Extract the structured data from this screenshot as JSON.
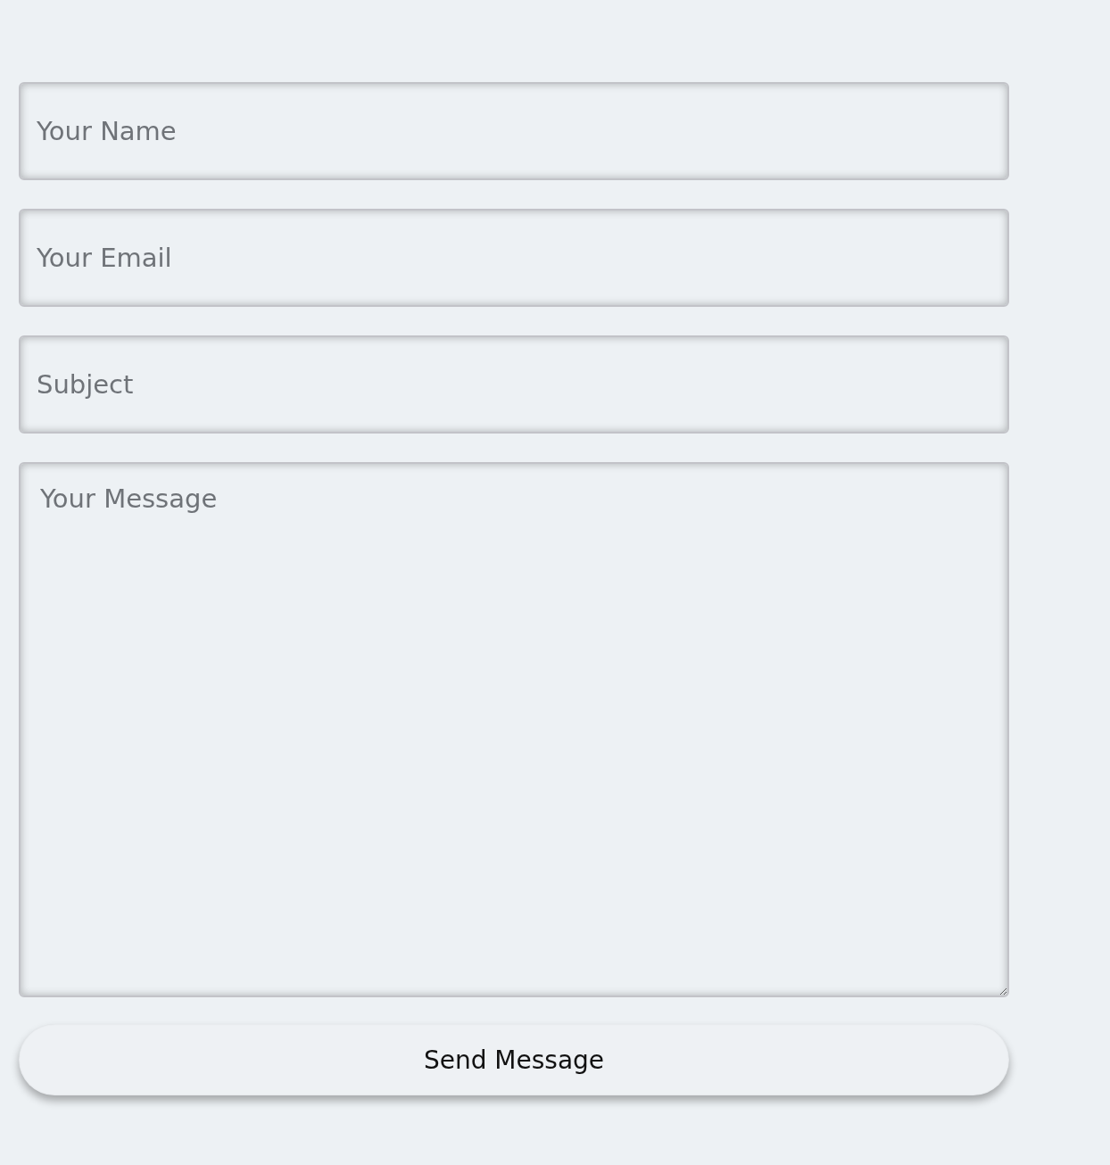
{
  "form": {
    "fields": [
      {
        "kind": "input",
        "placeholder": "Your Name"
      },
      {
        "kind": "input",
        "placeholder": "Your Email"
      },
      {
        "kind": "input",
        "placeholder": "Subject"
      },
      {
        "kind": "textarea",
        "placeholder": "Your Message"
      }
    ],
    "submit": {
      "label": "Send Message"
    }
  }
}
